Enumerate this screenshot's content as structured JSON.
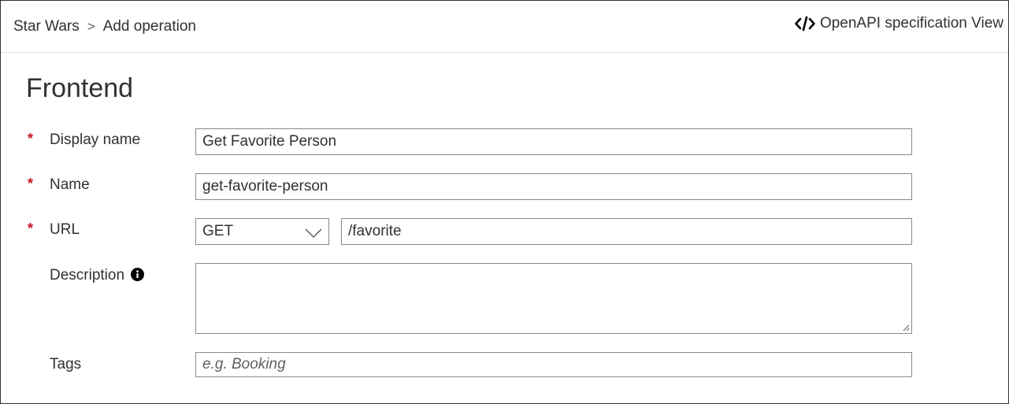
{
  "breadcrumb": {
    "items": [
      "Star Wars",
      "Add operation"
    ],
    "separator": ">"
  },
  "header": {
    "openapi_label": "OpenAPI specification View",
    "openapi_icon": "code-icon"
  },
  "section": {
    "title": "Frontend"
  },
  "form": {
    "required_mark": "*",
    "display_name": {
      "label": "Display name",
      "value": "Get Favorite Person"
    },
    "name": {
      "label": "Name",
      "value": "get-favorite-person"
    },
    "url": {
      "label": "URL",
      "method": "GET",
      "path": "/favorite"
    },
    "description": {
      "label": "Description",
      "value": "",
      "icon": "info-icon"
    },
    "tags": {
      "label": "Tags",
      "placeholder": "e.g. Booking"
    }
  },
  "colors": {
    "required": "#c50f1f",
    "text": "#323130",
    "border": "#8a8886"
  }
}
